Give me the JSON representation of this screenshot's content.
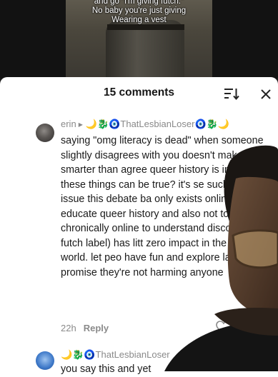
{
  "video": {
    "caption_lines": [
      "and go \"i'm giving futch.\"",
      "No baby you're just giving",
      "Wearing a vest"
    ]
  },
  "header": {
    "comment_count": "15 comments",
    "sort_icon": "sort-icon",
    "close_icon": "close-icon"
  },
  "comments": [
    {
      "username": "erin",
      "reply_to": "🌙🐉🧿ThatLesbianLoser🧿🐉🌙",
      "text": "saying \"omg literacy is dead\" when someone slightly disagrees with you doesn't make you smarter than agree queer history is important these things can be true? it's se such a non issue this debate ba only exists online. i am educate queer history and also not too chronically online to understand discourse (the futch label) has litt zero impact in the real world. let peo have fun and explore labels i promise they're not harming anyone",
      "time": "22h",
      "reply_label": "Reply"
    },
    {
      "username": "🌙🐉🧿ThatLesbianLoser",
      "text": "you say this and yet"
    }
  ],
  "colors": {
    "sheet_bg": "#ffffff",
    "text_primary": "#1a1a1a",
    "text_secondary": "#8a8a8a"
  }
}
